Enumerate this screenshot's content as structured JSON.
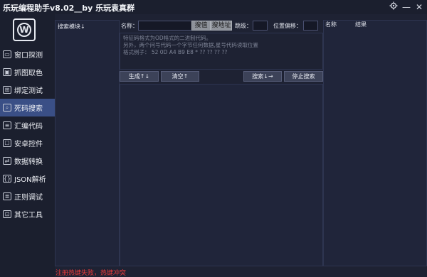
{
  "window": {
    "title": "乐玩编程助手v8.02__by 乐玩袁真群",
    "settings_icon": "gear-icon",
    "minimize_glyph": "—",
    "close_glyph": "✕"
  },
  "sidebar": {
    "logo_letter": "W",
    "items": [
      {
        "label": "窗口探测",
        "icon": "window-icon",
        "glyph": "▭"
      },
      {
        "label": "抓图取色",
        "icon": "capture-icon",
        "glyph": "▣"
      },
      {
        "label": "绑定测试",
        "icon": "bind-icon",
        "glyph": "⊞"
      },
      {
        "label": "死码搜索",
        "icon": "search-code-icon",
        "glyph": "⌕",
        "active": true
      },
      {
        "label": "汇编代码",
        "icon": "assembly-icon",
        "glyph": "≡"
      },
      {
        "label": "安卓控件",
        "icon": "android-icon",
        "glyph": "☐"
      },
      {
        "label": "数据转换",
        "icon": "convert-icon",
        "glyph": "⇄"
      },
      {
        "label": "JSON解析",
        "icon": "json-icon",
        "glyph": "{}"
      },
      {
        "label": "正则调试",
        "icon": "regex-icon",
        "glyph": "≣"
      },
      {
        "label": "其它工具",
        "icon": "tools-icon",
        "glyph": "⊡"
      }
    ]
  },
  "modules_panel": {
    "header": "搜索模块↓"
  },
  "search_bar": {
    "name_label": "名称：",
    "name_value": "",
    "search_value_btn": "搜值",
    "search_addr_btn": "搜地址",
    "jump_label": "跳级：",
    "jump_value": "",
    "offset_label": "位置偏移：",
    "offset_value": ""
  },
  "hint": {
    "lines": [
      "特征码格式为OD格式的二进制代码。",
      "另外，两个问号代码一个字节任何数据,星号代码读取位置",
      "格式例子：  52 0D A4 B9 E8 * ?? ?? ?? ??"
    ]
  },
  "actions": {
    "generate": "生成↑↓",
    "clear": "清空↑",
    "search": "搜索↓→",
    "stop": "停止搜索"
  },
  "results_panel": {
    "col_name": "名称",
    "col_result": "结果"
  },
  "status": {
    "message": "注册热键失败，热键冲突"
  }
}
